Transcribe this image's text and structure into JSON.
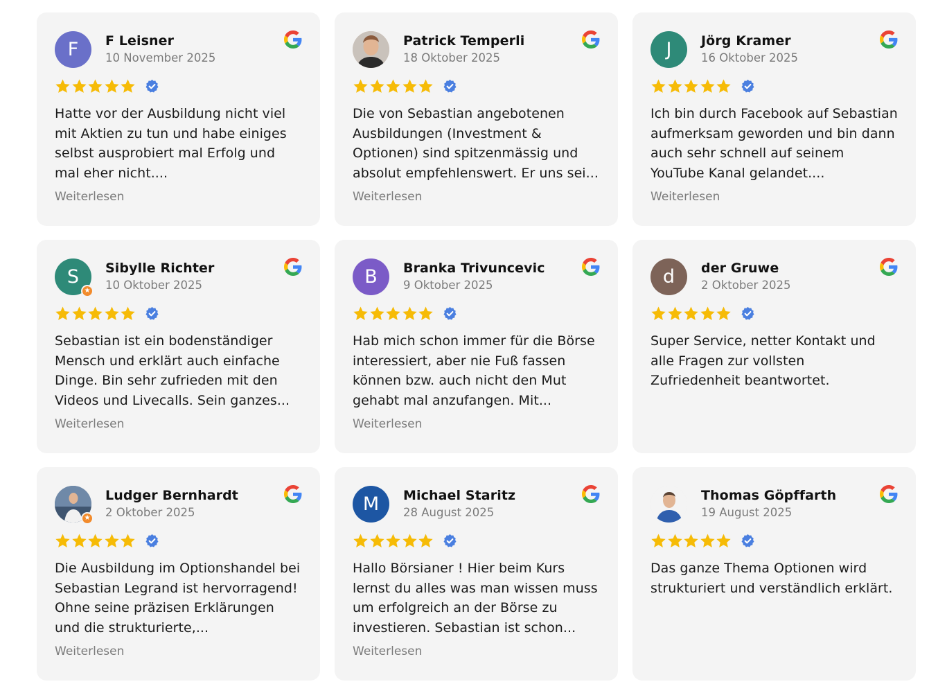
{
  "colors": {
    "card_bg": "#f4f4f4",
    "star": "#f6bb06",
    "verified": "#4a7fe0",
    "muted_text": "#7a7a7a"
  },
  "reviews": [
    {
      "name": "F Leisner",
      "date": "10 November 2025",
      "initial": "F",
      "avatar_color": "#6a70c9",
      "avatar_type": "initial",
      "rating": 5,
      "text": "Hatte vor der Ausbildung nicht viel mit Aktien zu tun und habe einiges selbst ausprobiert mal Erfolg und mal eher nicht....",
      "more": "Weiterlesen"
    },
    {
      "name": "Patrick Temperli",
      "date": "18 Oktober 2025",
      "initial": "",
      "avatar_color": "#d9b8a0",
      "avatar_type": "photo",
      "rating": 5,
      "text": "Die von Sebastian angebotenen Ausbildungen (Investment & Optionen) sind spitzenmässig und absolut empfehlenswert. Er uns sei...",
      "more": "Weiterlesen"
    },
    {
      "name": "Jörg Kramer",
      "date": "16 Oktober 2025",
      "initial": "J",
      "avatar_color": "#2e8a78",
      "avatar_type": "initial",
      "rating": 5,
      "text": "Ich bin durch Facebook auf Sebastian aufmerksam geworden und bin dann auch sehr schnell auf seinem YouTube Kanal gelandet....",
      "more": "Weiterlesen"
    },
    {
      "name": "Sibylle Richter",
      "date": "10 Oktober 2025",
      "initial": "S",
      "avatar_color": "#2e8a78",
      "avatar_type": "initial-badge",
      "rating": 5,
      "text": "Sebastian ist ein bodenständiger Mensch und erklärt auch einfache Dinge. Bin sehr zufrieden mit den Videos und Livecalls. Sein ganzes...",
      "more": "Weiterlesen"
    },
    {
      "name": "Branka Trivuncevic",
      "date": "9 Oktober 2025",
      "initial": "B",
      "avatar_color": "#7b5bc7",
      "avatar_type": "initial",
      "rating": 5,
      "text": "Hab mich schon immer für die Börse interessiert, aber nie Fuß fassen können bzw. auch nicht den Mut gehabt mal anzufangen. Mit...",
      "more": "Weiterlesen"
    },
    {
      "name": "der Gruwe",
      "date": "2 Oktober 2025",
      "initial": "d",
      "avatar_color": "#7d6358",
      "avatar_type": "initial",
      "rating": 5,
      "text": "Super Service, netter Kontakt und alle Fragen zur vollsten Zufriedenheit beantwortet.",
      "more": ""
    },
    {
      "name": "Ludger Bernhardt",
      "date": "2 Oktober 2025",
      "initial": "",
      "avatar_color": "#5d7694",
      "avatar_type": "photo-badge",
      "rating": 5,
      "text": "Die Ausbildung im Optionshandel bei Sebastian Legrand ist hervorragend! Ohne seine präzisen Erklärungen und die strukturierte,...",
      "more": "Weiterlesen"
    },
    {
      "name": "Michael Staritz",
      "date": "28 August 2025",
      "initial": "M",
      "avatar_color": "#1d56a3",
      "avatar_type": "initial",
      "rating": 5,
      "text": "Hallo Börsianer ! Hier beim Kurs lernst du alles was man wissen muss um erfolgreich an der Börse zu investieren. Sebastian ist schon...",
      "more": "Weiterlesen"
    },
    {
      "name": "Thomas Göpffarth",
      "date": "19 August 2025",
      "initial": "",
      "avatar_color": "#e8e8e8",
      "avatar_type": "photo-white",
      "rating": 5,
      "text": "Das ganze Thema Optionen wird strukturiert und verständlich erklärt.",
      "more": ""
    }
  ]
}
